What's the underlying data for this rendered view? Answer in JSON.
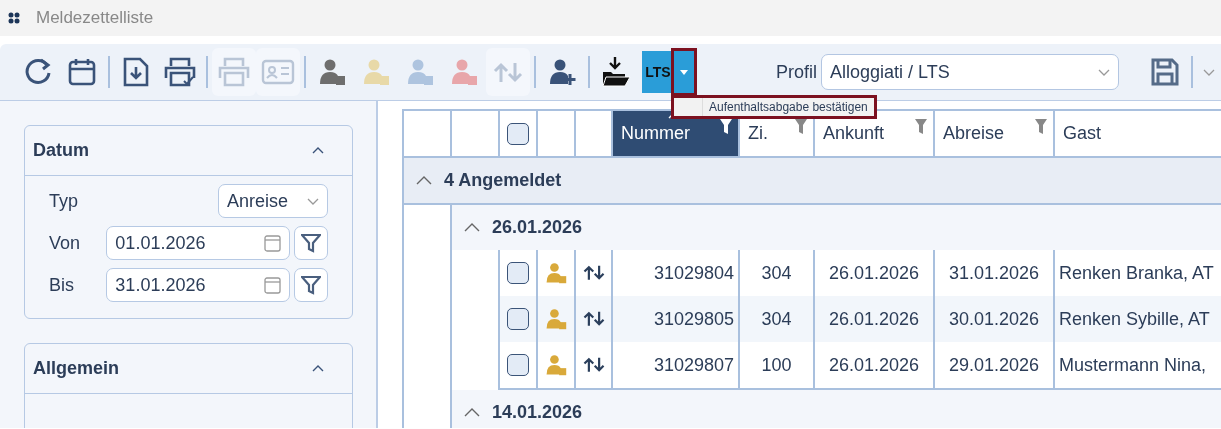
{
  "window": {
    "title": "Meldezettelliste"
  },
  "toolbar": {
    "buttons": [
      {
        "kind": "refresh",
        "disabled": false
      },
      {
        "kind": "calendar",
        "disabled": false
      },
      {
        "kind": "separator"
      },
      {
        "kind": "export",
        "disabled": false
      },
      {
        "kind": "print-check",
        "disabled": false
      },
      {
        "kind": "separator"
      },
      {
        "kind": "print",
        "disabled": true
      },
      {
        "kind": "id-card",
        "disabled": true
      },
      {
        "kind": "separator"
      },
      {
        "kind": "person",
        "color": "#6e6e6e"
      },
      {
        "kind": "person",
        "color": "#e8d9a8"
      },
      {
        "kind": "person",
        "color": "#aec4df"
      },
      {
        "kind": "person",
        "color": "#e8a6aa"
      },
      {
        "kind": "arrows",
        "disabled": true
      },
      {
        "kind": "separator"
      },
      {
        "kind": "person-add",
        "disabled": false
      },
      {
        "kind": "separator"
      },
      {
        "kind": "import"
      },
      {
        "kind": "text",
        "label": "LTS"
      },
      {
        "kind": "dropdown",
        "open": true
      }
    ],
    "menu": {
      "items": [
        {
          "label": "Aufenthaltsabgabe bestätigen"
        }
      ]
    },
    "profile": {
      "label": "Profil",
      "value": "Alloggiati / LTS"
    }
  },
  "sidebar": {
    "panels": [
      {
        "title": "Datum",
        "expanded": true,
        "fields": [
          {
            "kind": "select",
            "label": "Typ",
            "value": "Anreise"
          },
          {
            "kind": "date",
            "label": "Von",
            "value": "01.01.2026"
          },
          {
            "kind": "date",
            "label": "Bis",
            "value": "31.01.2026"
          }
        ]
      },
      {
        "title": "Allgemein",
        "expanded": true
      }
    ]
  },
  "table": {
    "header_checked": false,
    "columns": [
      {
        "label": "Nummer",
        "sorted": true,
        "filter": true
      },
      {
        "label": "Zi.",
        "sorted": false,
        "filter": true
      },
      {
        "label": "Ankunft",
        "sorted": false,
        "filter": true
      },
      {
        "label": "Abreise",
        "sorted": false,
        "filter": true
      },
      {
        "label": "Gast",
        "sorted": false,
        "filter": false
      }
    ],
    "groups": [
      {
        "label": "4 Angemeldet",
        "expanded": true,
        "children": [
          {
            "label": "26.01.2026",
            "expanded": true,
            "rows": [
              {
                "checked": false,
                "number": "31029804",
                "room": "304",
                "arrival": "26.01.2026",
                "departure": "31.01.2026",
                "guest": "Renken Branka, AT"
              },
              {
                "checked": false,
                "number": "31029805",
                "room": "304",
                "arrival": "26.01.2026",
                "departure": "30.01.2026",
                "guest": "Renken Sybille, AT"
              },
              {
                "checked": false,
                "number": "31029807",
                "room": "100",
                "arrival": "26.01.2026",
                "departure": "29.01.2026",
                "guest": "Mustermann Nina,"
              }
            ]
          },
          {
            "label": "14.01.2026",
            "expanded": true
          }
        ]
      }
    ]
  }
}
